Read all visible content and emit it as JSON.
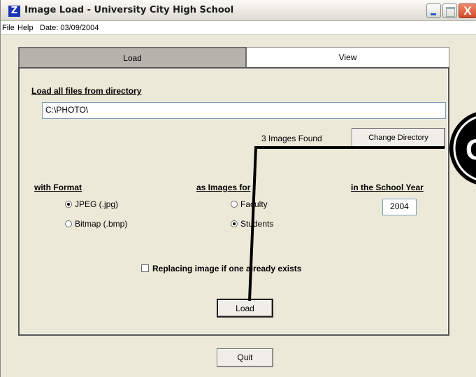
{
  "window": {
    "title": "Image Load - University City High School",
    "icon_glyph": "Z",
    "close_glyph": "X"
  },
  "menu": {
    "file": "File",
    "help": "Help",
    "date": "Date: 03/09/2004"
  },
  "tabs": {
    "load": "Load",
    "view": "View"
  },
  "directory": {
    "label": "Load all files from directory",
    "path": "C:\\PHOTO\\",
    "found_text": "3 Images Found",
    "change_button": "Change Directory"
  },
  "format": {
    "label": "with Format",
    "options": [
      {
        "label": "JPEG (.jpg)",
        "selected": true
      },
      {
        "label": "Bitmap (.bmp)",
        "selected": false
      }
    ]
  },
  "images_for": {
    "label": "as Images for",
    "options": [
      {
        "label": "Faculty",
        "selected": false
      },
      {
        "label": "Students",
        "selected": true
      }
    ]
  },
  "school_year": {
    "label": "in the School Year",
    "value": "2004"
  },
  "replace_checkbox": {
    "label": "Replacing image if one already exists",
    "checked": false
  },
  "load_button": "Load",
  "quit_button": "Quit",
  "callout": {
    "label": "C"
  }
}
